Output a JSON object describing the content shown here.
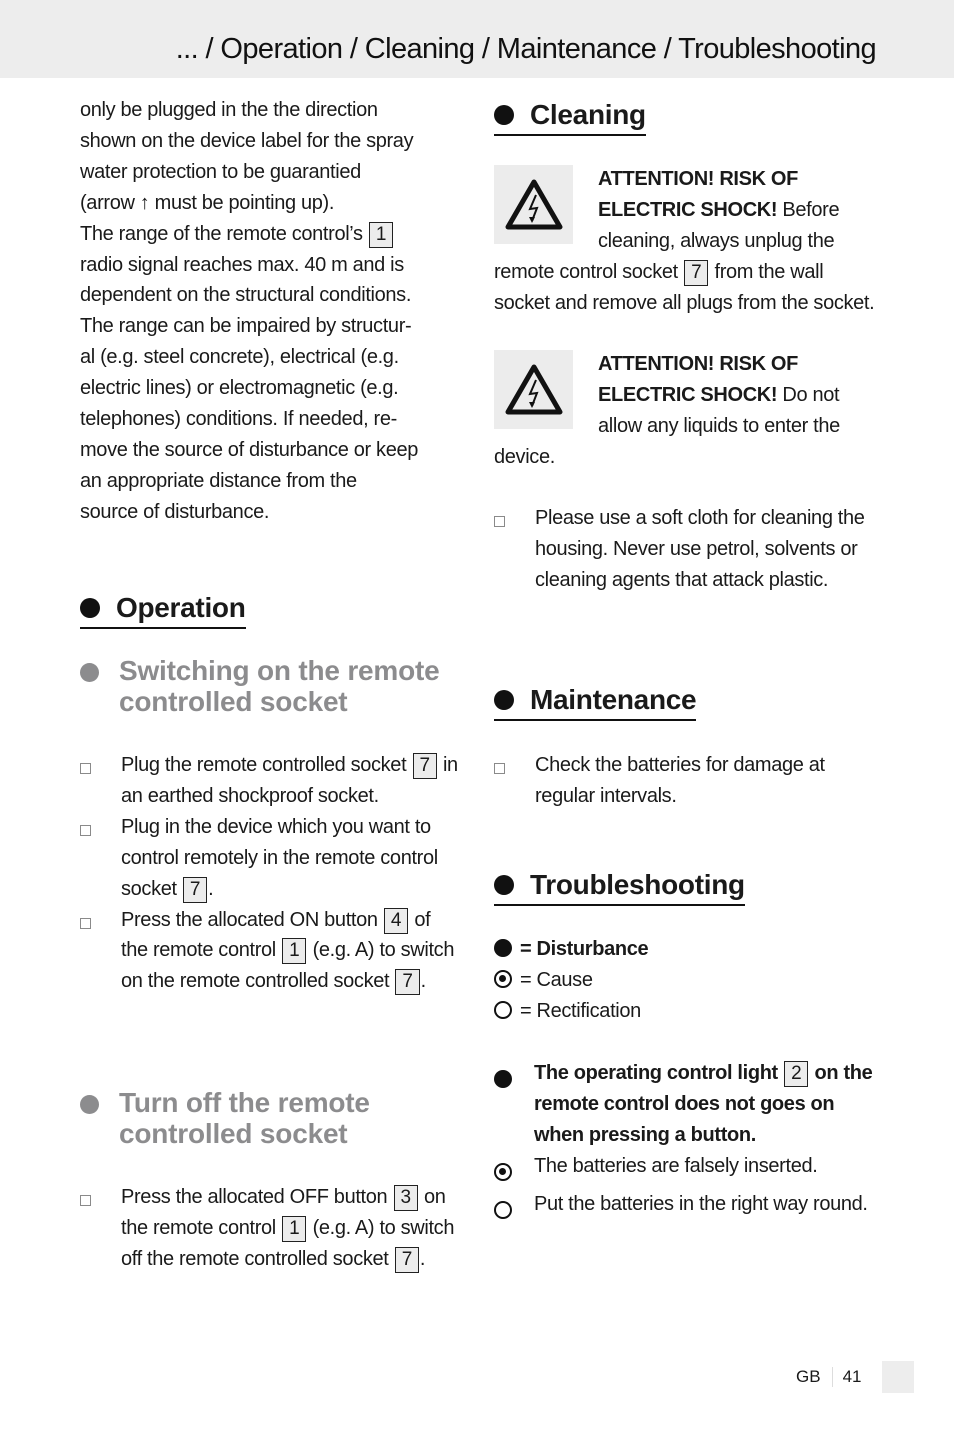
{
  "header": {
    "title": "... / Operation / Cleaning / Maintenance / Troubleshooting"
  },
  "left": {
    "intro_lines": [
      "only be plugged in the the direction",
      "shown on the device label for the spray",
      "water protection to be guarantied",
      "(arrow ↑ must be pointing up)."
    ],
    "range_a": "The range of the remote control’s",
    "range_ref": "1",
    "range_lines": [
      "radio signal reaches max. 40 m and is",
      "dependent on the structural conditions.",
      "The range can be impaired by structur-",
      "al (e.g. steel concrete), electrical (e.g.",
      "electric lines) or electromagnetic (e.g.",
      "telephones) conditions. If needed, re-",
      "move the source of disturbance or keep",
      "an appropriate distance from the",
      "source of disturbance."
    ],
    "operation_heading": "Operation",
    "switch_on_heading": [
      "Switching on the remote",
      "controlled socket"
    ],
    "switch_on_steps": [
      {
        "a": "Plug the remote controlled socket",
        "ref": "7",
        "b": "in an earthed shockproof socket."
      },
      {
        "a": "Plug in the device which you want to control remotely in the remote control socket",
        "ref": "7",
        "b": "."
      },
      {
        "a": "Press the allocated ON button",
        "ref": "4",
        "b": "of the remote control",
        "ref2": "1",
        "c": "(e.g. A) to switch on the remote controlled socket",
        "ref3": "7",
        "d": "."
      }
    ],
    "switch_off_heading": [
      "Turn off the remote",
      "controlled socket"
    ],
    "switch_off_steps": [
      {
        "a": "Press the allocated OFF button",
        "ref": "3",
        "b": "on the remote control",
        "ref2": "1",
        "c": "(e.g. A) to switch off the remote controlled socket",
        "ref3": "7",
        "d": "."
      }
    ]
  },
  "right": {
    "cleaning_heading": "Cleaning",
    "warning1": {
      "bold": "ATTENTION! RISK OF ELECTRIC SHOCK!",
      "a": "Before cleaning, always unplug the remote control socket",
      "ref": "7",
      "b": "from the wall socket and remove all plugs from the socket."
    },
    "warning2": {
      "bold": "ATTENTION! RISK OF ELECTRIC SHOCK!",
      "a": "Do not allow any liquids to enter the device."
    },
    "cleaning_step": "Please use a soft cloth for cleaning the housing. Never use petrol, solvents or cleaning agents that attack plastic.",
    "maintenance_heading": "Maintenance",
    "maintenance_step": "Check the batteries for damage at regular intervals.",
    "troubleshooting_heading": "Troubleshooting",
    "legend": {
      "disturbance": "= Disturbance",
      "cause": "= Cause",
      "rectification": "= Rectification"
    },
    "problem": {
      "a": "The operating control light",
      "ref": "2",
      "b": "on the remote control does not goes on when pressing a button."
    },
    "cause": "The batteries are falsely inserted.",
    "rectification": "Put the batteries in the right way round."
  },
  "footer": {
    "lang": "GB",
    "page": "41"
  }
}
